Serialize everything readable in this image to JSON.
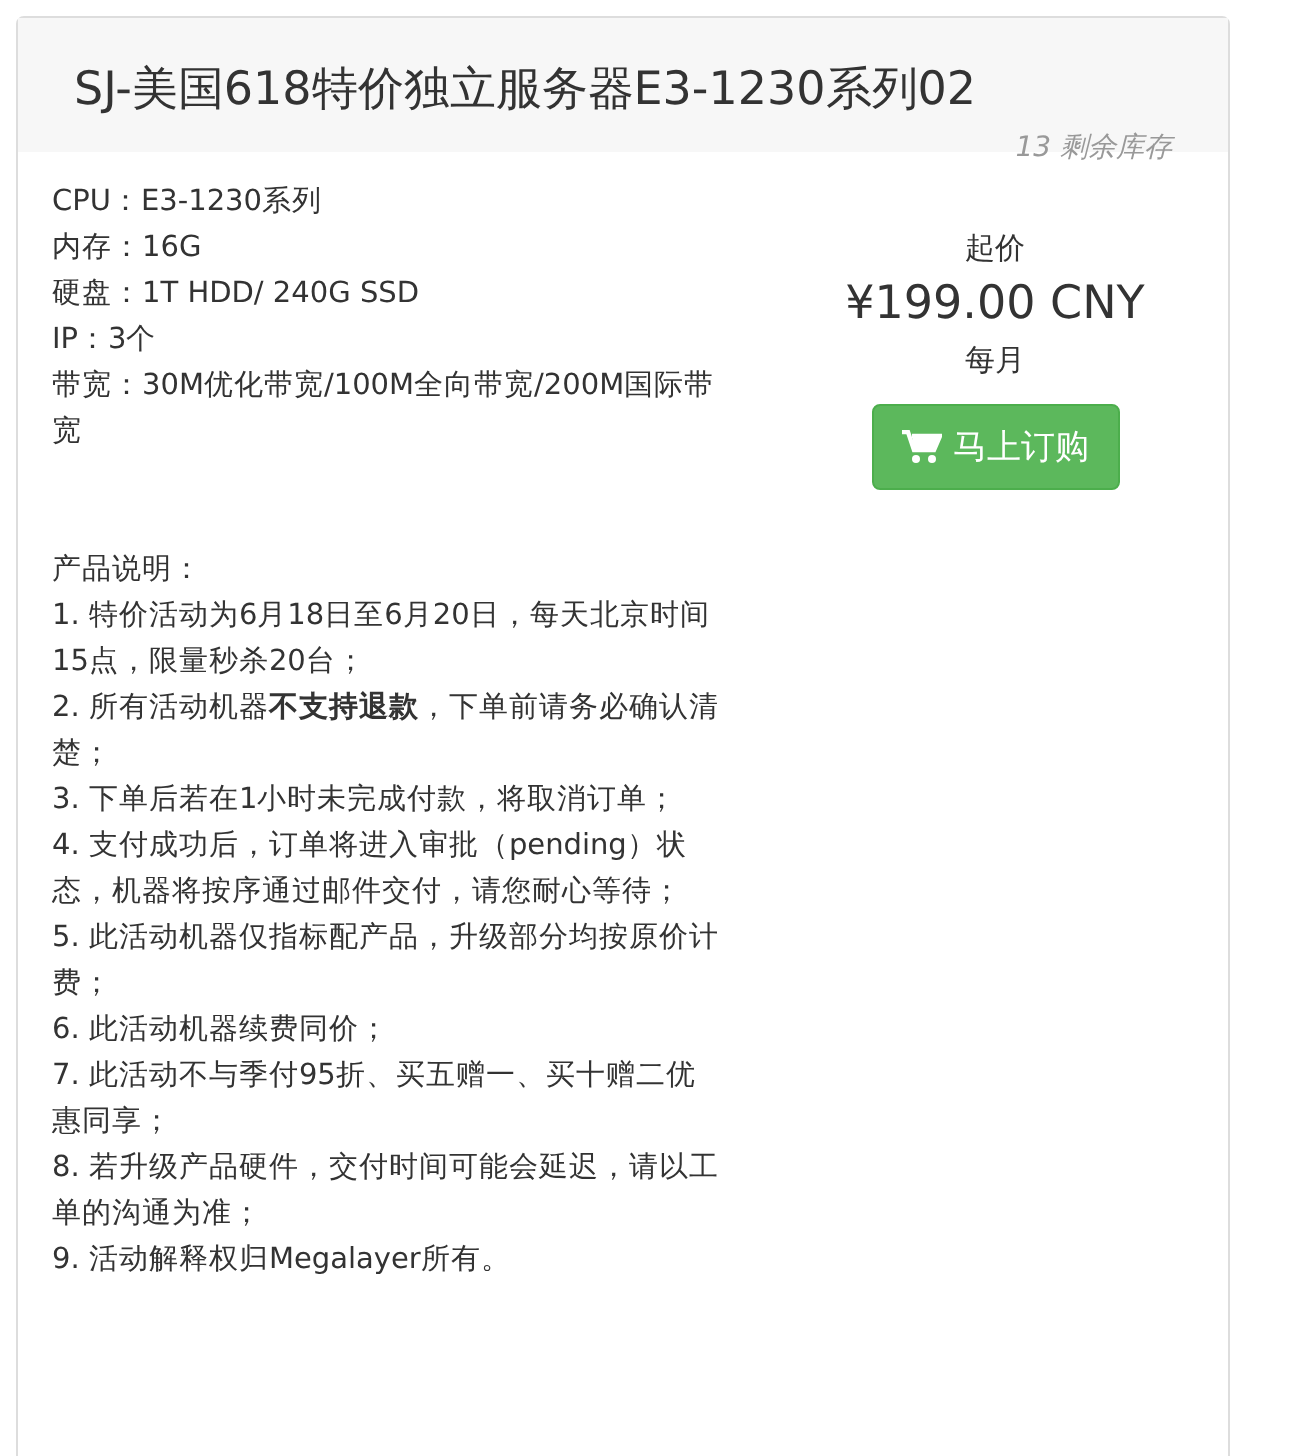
{
  "product": {
    "title": "SJ-美国618特价独立服务器E3-1230系列02",
    "stock": "13 剩余库存",
    "specs": [
      "CPU：E3-1230系列",
      "内存：16G",
      "硬盘：1T HDD/ 240G SSD",
      "IP：3个",
      "带宽：30M优化带宽/100M全向带宽/200M国际带宽"
    ],
    "notes_heading": "产品说明：",
    "notes": [
      "1. 特价活动为6月18日至6月20日，每天北京时间15点，限量秒杀20台；",
      "2. 所有活动机器**不支持退款**，下单前请务必确认清楚；",
      "3. 下单后若在1小时未完成付款，将取消订单；",
      "4. 支付成功后，订单将进入审批（pending）状态，机器将按序通过邮件交付，请您耐心等待；",
      "5. 此活动机器仅指标配产品，升级部分均按原价计费；",
      "6. 此活动机器续费同价；",
      "7. 此活动不与季付95折、买五赠一、买十赠二优惠同享；",
      "8. 若升级产品硬件，交付时间可能会延迟，请以工单的沟通为准；",
      "9. 活动解释权归Megalayer所有。"
    ],
    "price_label": "起价",
    "price": "¥199.00 CNY",
    "period": "每月",
    "order_button": "马上订购"
  }
}
